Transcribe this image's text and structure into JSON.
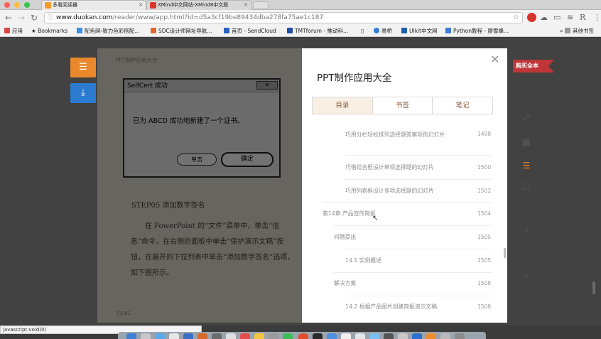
{
  "browser": {
    "tabs": [
      {
        "title": "多看阅读器",
        "active": true,
        "favicon_color": "#f39a2b"
      },
      {
        "title": "XMind中文网站-XMind8中文版",
        "active": false,
        "favicon_color": "#d9372c"
      }
    ],
    "url_host": "www.duokan.com",
    "url_path": "/reader/www/app.html?id=d5a3cf19be89434dba278fa75ae1c187",
    "bookmarks": [
      {
        "label": "应用",
        "color": "#d44"
      },
      {
        "label": "Bookmarks",
        "color": "#555"
      },
      {
        "label": "配色网-致力色彩搭配...",
        "color": "#3a8ee6"
      },
      {
        "label": "SDC设计师网址导航...",
        "color": "#e26a2c"
      },
      {
        "label": "首页 - SendCloud",
        "color": "#2b5fbf"
      },
      {
        "label": "TMTforum - 推动科...",
        "color": "#1f4fa8"
      },
      {
        "label": "",
        "color": "#777"
      },
      {
        "label": "易桥",
        "color": "#2f7ed8"
      },
      {
        "label": "UIkit中文网",
        "color": "#1f5fb0"
      },
      {
        "label": "Python教程 - 廖雪峰...",
        "color": "#3b7bd9"
      }
    ],
    "other_bookmarks": "其他书签",
    "status_text": "javascript:void(0)"
  },
  "reader": {
    "book_title": "PPT制作应用大全",
    "buy_label": "购买全本",
    "dialog": {
      "title": "SelfCert 成功",
      "message": "已为 ABCD 成功地新建了一个证书。",
      "cancel": "单击",
      "ok": "确定"
    },
    "step_heading": "STEP05    添加数字签名",
    "paragraph": "在 PowerPoint 的“文件”菜单中，单击“信息”命令，在右侧的面板中单击“保护演示文稿”按钮，在展开的下拉列表中单击“添加数字签名”选项，如下图所示。",
    "page_number": "53/61"
  },
  "toc_panel": {
    "title": "PPT制作应用大全",
    "tabs": [
      {
        "label": "目录",
        "active": true
      },
      {
        "label": "书签",
        "active": false
      },
      {
        "label": "笔记",
        "active": false
      }
    ],
    "items": [
      {
        "label": "巧用分栏轻松排列选择题答案项的幻灯片",
        "page": "1498"
      },
      {
        "label": "巧借组合框设计单项选择题的幻灯片",
        "page": "1500"
      },
      {
        "label": "巧用列表框设计多项选择题的幻灯片",
        "page": "1502"
      },
      {
        "label": "第14章 产品宣传简报",
        "page": "1504"
      },
      {
        "label": "问题提出",
        "page": "1505"
      },
      {
        "label": "14.1 实例概述",
        "page": "1505"
      },
      {
        "label": "解决方案",
        "page": "1508"
      },
      {
        "label": "14.2 根据产品图片创建简报演示文稿",
        "page": "1508"
      }
    ]
  }
}
